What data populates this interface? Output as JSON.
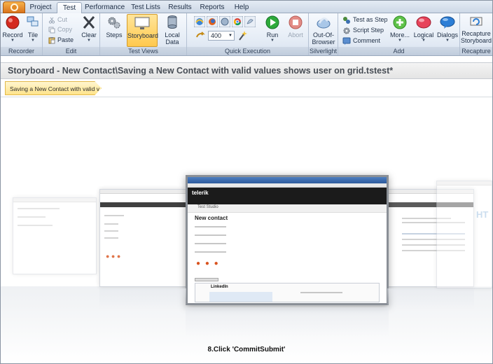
{
  "tabs": [
    {
      "label": "Project",
      "active": false
    },
    {
      "label": "Test",
      "active": true
    },
    {
      "label": "Performance",
      "active": false
    },
    {
      "label": "Test Lists",
      "active": false
    },
    {
      "label": "Results",
      "active": false
    },
    {
      "label": "Reports",
      "active": false
    },
    {
      "label": "Help",
      "active": false
    }
  ],
  "ribbon": {
    "recorder": {
      "label": "Recorder",
      "record": "Record",
      "tile": "Tile"
    },
    "edit": {
      "label": "Edit",
      "cut": "Cut",
      "copy": "Copy",
      "paste": "Paste",
      "clear": "Clear"
    },
    "test_views": {
      "label": "Test Views",
      "steps": "Steps",
      "storyboard": "Storyboard",
      "local_data": "Local Data"
    },
    "quick_execution": {
      "label": "Quick Execution",
      "speed_value": "400",
      "run": "Run",
      "abort": "Abort"
    },
    "silverlight": {
      "label": "Silverlight",
      "out_of_browser": "Out-Of-Browser"
    },
    "add": {
      "label": "Add",
      "test_as_step": "Test as Step",
      "script_step": "Script Step",
      "comment": "Comment",
      "more": "More...",
      "logical": "Logical",
      "dialogs": "Dialogs"
    },
    "recapture": {
      "label": "Recapture",
      "recapture_storyboard": "Recapture Storyboard"
    }
  },
  "document": {
    "title": "Storyboard - New Contact\\Saving a New Contact with valid values shows user on grid.tstest*",
    "breadcrumb": "Saving a New Contact with valid v..."
  },
  "storyboard": {
    "current_step_caption": "8.Click 'CommitSubmit'",
    "center_card": {
      "page_heading": "New contact",
      "brand": "telerik",
      "subtitle": "Test Studio",
      "button_text": "LinkedIn"
    }
  },
  "colors": {
    "accent": "#ffc94e",
    "ribbon_bg": "#e6edf6",
    "title_bar": "#2c5a9c"
  }
}
